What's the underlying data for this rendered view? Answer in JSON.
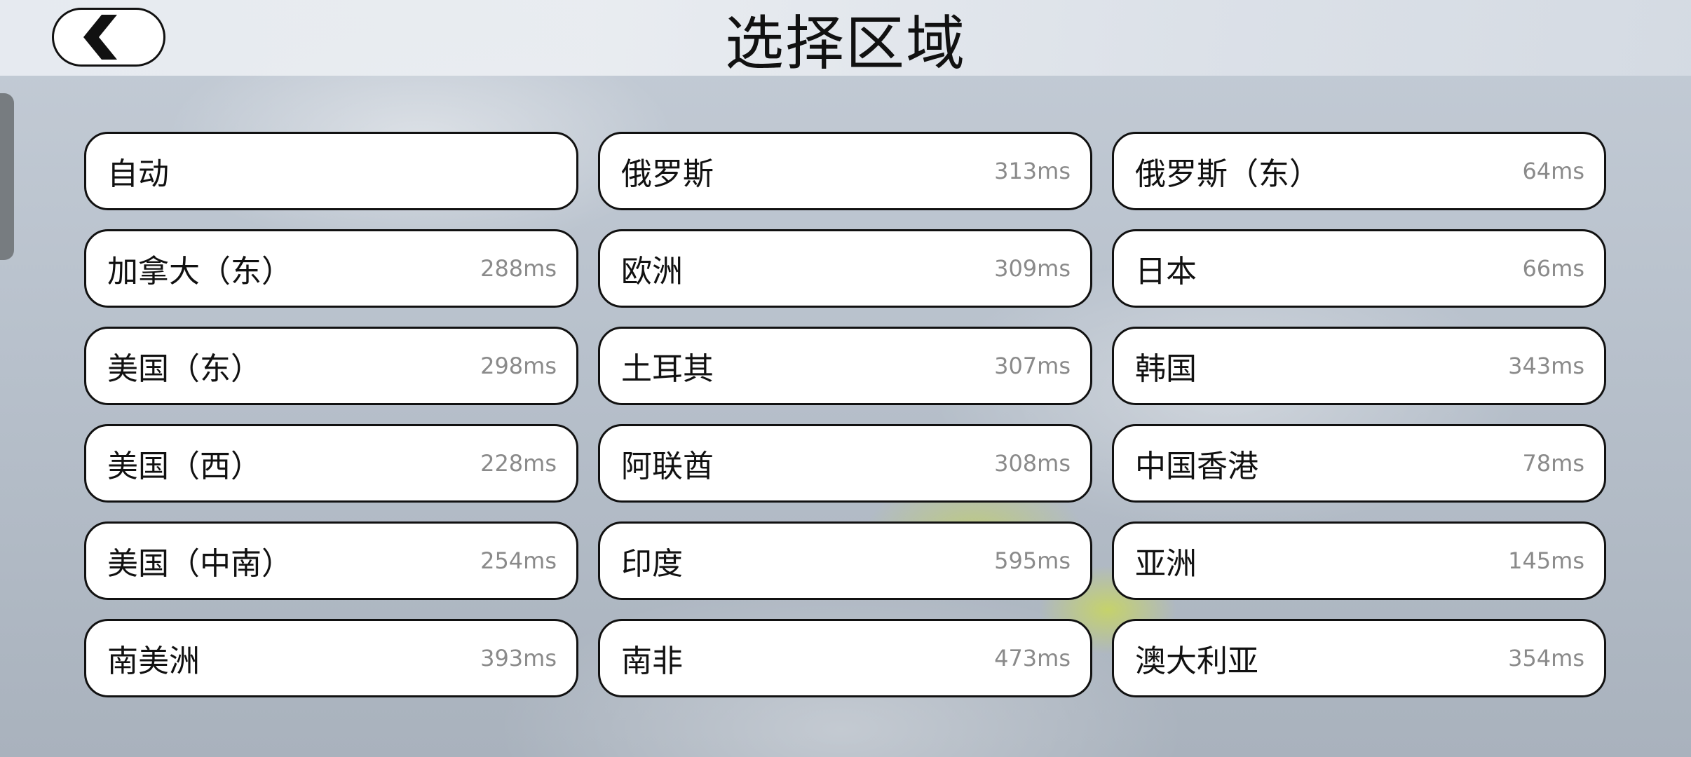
{
  "header": {
    "title": "选择区域",
    "back_icon": "chevron-left-icon"
  },
  "regions": [
    {
      "name": "自动",
      "ping": ""
    },
    {
      "name": "俄罗斯",
      "ping": "313ms"
    },
    {
      "name": "俄罗斯（东）",
      "ping": "64ms"
    },
    {
      "name": "加拿大（东）",
      "ping": "288ms"
    },
    {
      "name": "欧洲",
      "ping": "309ms"
    },
    {
      "name": "日本",
      "ping": "66ms"
    },
    {
      "name": "美国（东）",
      "ping": "298ms"
    },
    {
      "name": "土耳其",
      "ping": "307ms"
    },
    {
      "name": "韩国",
      "ping": "343ms"
    },
    {
      "name": "美国（西）",
      "ping": "228ms"
    },
    {
      "name": "阿联酋",
      "ping": "308ms"
    },
    {
      "name": "中国香港",
      "ping": "78ms"
    },
    {
      "name": "美国（中南）",
      "ping": "254ms"
    },
    {
      "name": "印度",
      "ping": "595ms"
    },
    {
      "name": "亚洲",
      "ping": "145ms"
    },
    {
      "name": "南美洲",
      "ping": "393ms"
    },
    {
      "name": "南非",
      "ping": "473ms"
    },
    {
      "name": "澳大利亚",
      "ping": "354ms"
    }
  ],
  "colors": {
    "border": "#111111",
    "button_bg": "#ffffff",
    "ping_text": "#8a8a8a"
  }
}
